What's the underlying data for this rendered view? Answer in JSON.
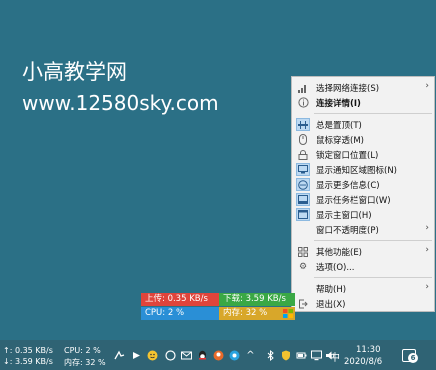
{
  "watermark": {
    "title": "小高教学网",
    "url": "www.12580sky.com"
  },
  "menu": {
    "items": [
      {
        "label": "选择网络连接(S)",
        "icon": "signal-icon",
        "submenu": true,
        "bold": false,
        "checked": false
      },
      {
        "label": "连接详情(I)",
        "icon": "info-icon",
        "submenu": false,
        "bold": true,
        "checked": false
      },
      {
        "label": "总是置顶(T)",
        "icon": "pin-icon",
        "submenu": false,
        "bold": false,
        "checked": true
      },
      {
        "label": "鼠标穿透(M)",
        "icon": "mouse-icon",
        "submenu": false,
        "bold": false,
        "checked": false
      },
      {
        "label": "锁定窗口位置(L)",
        "icon": "lock-icon",
        "submenu": false,
        "bold": false,
        "checked": false
      },
      {
        "label": "显示通知区域图标(N)",
        "icon": "tray-icon",
        "submenu": false,
        "bold": false,
        "checked": true
      },
      {
        "label": "显示更多信息(C)",
        "icon": "more-info-icon",
        "submenu": false,
        "bold": false,
        "checked": true
      },
      {
        "label": "显示任务栏窗口(W)",
        "icon": "taskbar-window-icon",
        "submenu": false,
        "bold": false,
        "checked": true
      },
      {
        "label": "显示主窗口(H)",
        "icon": "main-window-icon",
        "submenu": false,
        "bold": false,
        "checked": true
      },
      {
        "label": "窗口不透明度(P)",
        "icon": "",
        "submenu": true,
        "bold": false,
        "checked": false
      },
      {
        "label": "其他功能(E)",
        "icon": "grid-icon",
        "submenu": true,
        "bold": false,
        "checked": false
      },
      {
        "label": "选项(O)...",
        "icon": "gear-icon",
        "submenu": false,
        "bold": false,
        "checked": false
      },
      {
        "label": "帮助(H)",
        "icon": "",
        "submenu": true,
        "bold": false,
        "checked": false
      },
      {
        "label": "退出(X)",
        "icon": "exit-icon",
        "submenu": false,
        "bold": false,
        "checked": false
      }
    ]
  },
  "speed_widget": {
    "upload": "上传: 0.35 KB/s",
    "download": "下载: 3.59 KB/s",
    "cpu": "CPU: 2 %",
    "memory": "内存: 32 %"
  },
  "taskbar": {
    "up_speed": "↑: 0.35 KB/s",
    "down_speed": "↓: 3.59 KB/s",
    "cpu": "CPU: 2 %",
    "memory": "内存: 32 %",
    "ime": "中",
    "time": "11:30",
    "date": "2020/8/6",
    "notifications": "6"
  },
  "colors": {
    "desktop": "#2b7086",
    "upload": "#e0443b",
    "download": "#3aa845",
    "cpu": "#2a8fd6",
    "memory": "#d8a72a"
  }
}
